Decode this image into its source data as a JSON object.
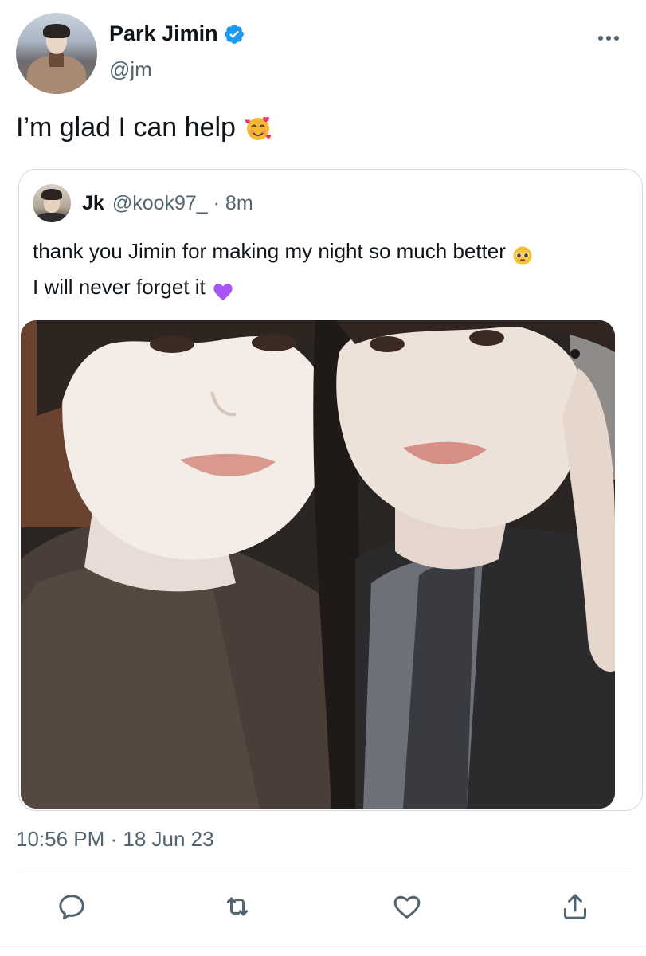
{
  "author": {
    "display_name": "Park Jimin",
    "handle": "@jm",
    "verified": true,
    "avatar_icon": "avatar"
  },
  "tweet": {
    "text": "I’m glad I can help",
    "emoji_icon": "smiling-face-with-hearts-icon",
    "timestamp": "10:56 PM · 18 Jun 23"
  },
  "quote": {
    "display_name": "Jk",
    "meta": "@kook97_ · 8m",
    "lines": [
      "thank you Jimin for making my night so much better",
      "I will never forget it"
    ],
    "line_icons": [
      "pleading-face-icon",
      "purple-heart-icon"
    ],
    "media": "photo"
  },
  "actions": [
    "reply-icon",
    "retweet-icon",
    "like-icon",
    "share-icon"
  ],
  "colors": {
    "text_primary": "#0f1419",
    "text_secondary": "#536471",
    "verified_blue": "#1d9bf0",
    "border": "#cfd9de",
    "purple_heart": "#a855f7"
  }
}
